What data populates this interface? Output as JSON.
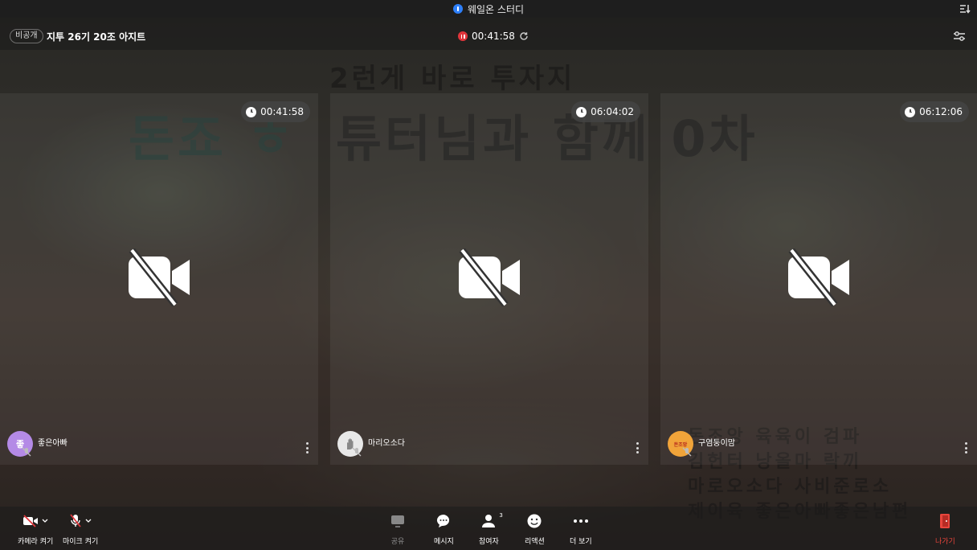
{
  "window": {
    "title": "웨일온 스터디"
  },
  "meeting": {
    "visibility_badge": "비공개",
    "room_title": "지투 26기 20조 아지트",
    "recording_time": "00:41:58"
  },
  "background_overlay": {
    "line1": "2런게 바로 투자지",
    "line2": "튜터님과 함께 0차",
    "line3": "돈죠 ㅎ",
    "names": [
      "돈조앙  육육이  검파",
      "김헌터  낭올마  락끼",
      "마로오소다  사비준로소",
      "제이육  좋은아빠좋은남편"
    ]
  },
  "participants": [
    {
      "name": "좋은아빠",
      "timer": "00:41:58",
      "avatar_text": "좋",
      "avatar_color": "#b48ae6"
    },
    {
      "name": "마리오소다",
      "timer": "06:04:02",
      "avatar_text": "",
      "avatar_color": "#e8e8e8"
    },
    {
      "name": "구염둥이맘",
      "timer": "06:12:06",
      "avatar_text": "돈조앙",
      "avatar_color": "#f1a43a"
    }
  ],
  "toolbar": {
    "camera_label": "카메라 켜기",
    "mic_label": "마이크 켜기",
    "share_label": "공유",
    "message_label": "메시지",
    "participants_label": "참여자",
    "participants_count": "3",
    "reaction_label": "리액션",
    "more_label": "더 보기",
    "leave_label": "나가기"
  },
  "colors": {
    "accent_blue": "#2d7ff9",
    "record_red": "#e0353b",
    "leave_red": "#e8453c"
  }
}
